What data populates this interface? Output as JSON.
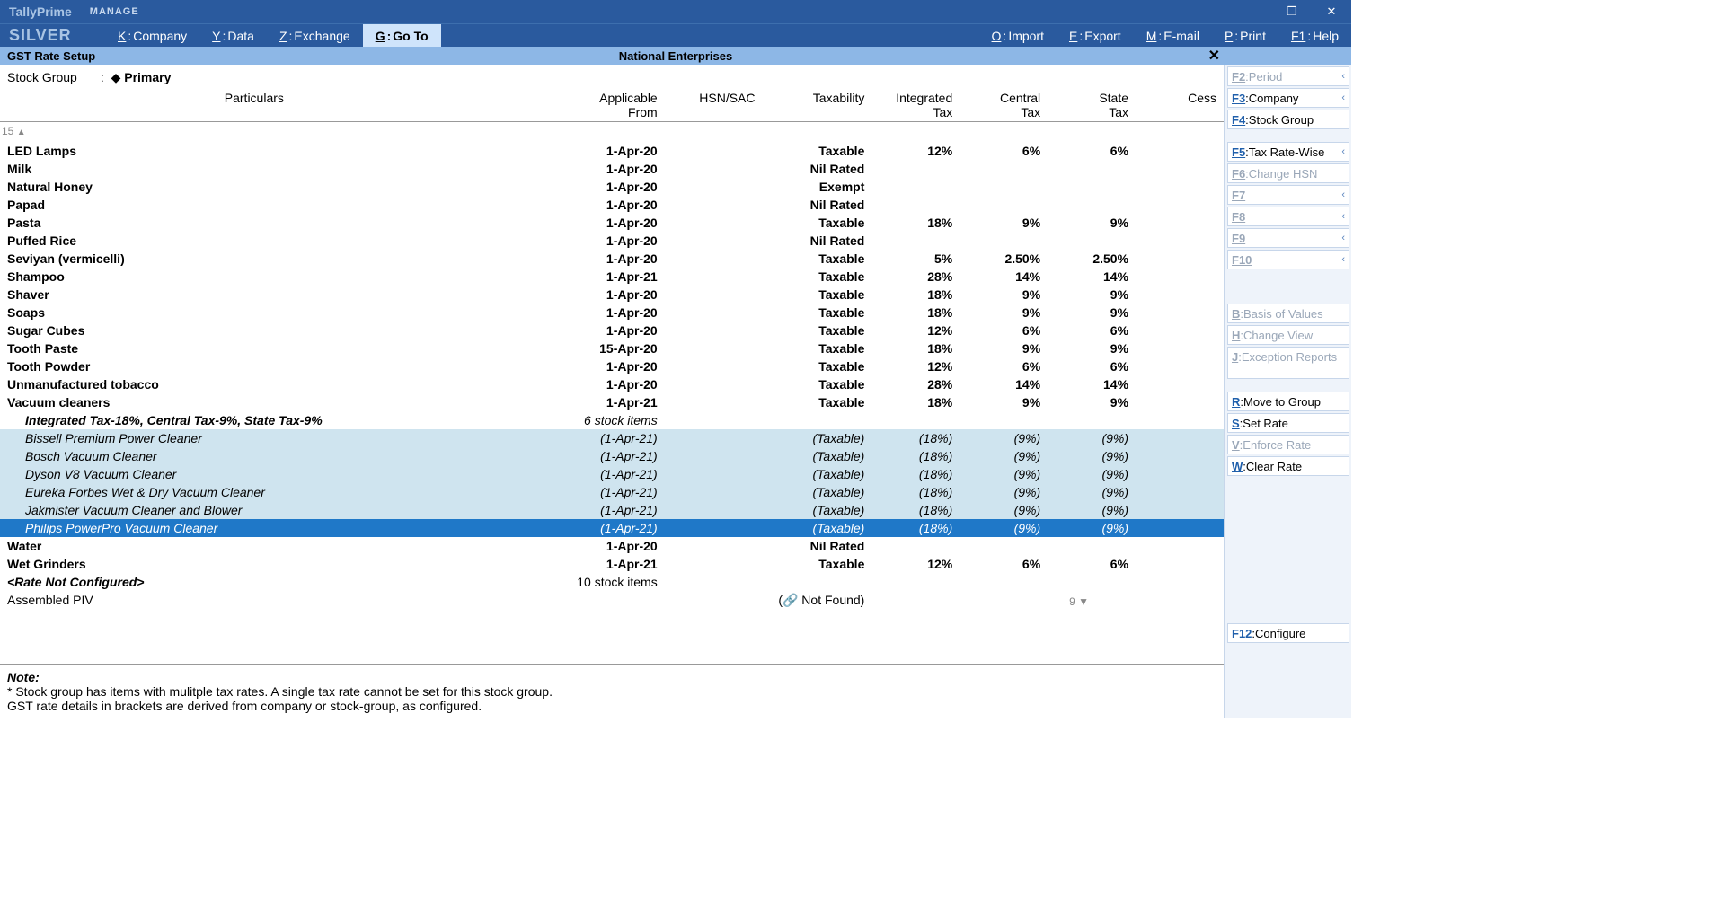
{
  "app": {
    "brand": "TallyPrime",
    "edition": "SILVER",
    "manage": "MANAGE"
  },
  "winbtn": {
    "min": "—",
    "max": "❐",
    "close": "✕"
  },
  "menu": [
    {
      "key": "K",
      "label": "Company"
    },
    {
      "key": "Y",
      "label": "Data"
    },
    {
      "key": "Z",
      "label": "Exchange"
    },
    {
      "key": "G",
      "label": "Go To",
      "active": true
    },
    {
      "key": "O",
      "label": "Import"
    },
    {
      "key": "E",
      "label": "Export"
    },
    {
      "key": "M",
      "label": "E-mail"
    },
    {
      "key": "P",
      "label": "Print"
    },
    {
      "key": "F1",
      "label": "Help"
    }
  ],
  "ctx": {
    "left": "GST Rate Setup",
    "center": "National Enterprises",
    "close": "✕"
  },
  "stockgroup": {
    "label": "Stock Group",
    "value": "Primary",
    "colon": ":",
    "diamond": "◆"
  },
  "columns": [
    "Particulars",
    "Applicable From",
    "HSN/SAC",
    "Taxability",
    "Integrated Tax",
    "Central Tax",
    "State Tax",
    "Cess"
  ],
  "topcount": "15",
  "toptri": "▲",
  "botcount": "9",
  "bottri": "▼",
  "rows": [
    {
      "t": "b",
      "p": "LED Lamps",
      "d": "1-Apr-20",
      "tx": "Taxable",
      "i": "12%",
      "c": "6%",
      "s": "6%"
    },
    {
      "t": "b",
      "p": "Milk",
      "d": "1-Apr-20",
      "tx": "Nil Rated"
    },
    {
      "t": "b",
      "p": "Natural Honey",
      "d": "1-Apr-20",
      "tx": "Exempt"
    },
    {
      "t": "b",
      "p": "Papad",
      "d": "1-Apr-20",
      "tx": "Nil Rated"
    },
    {
      "t": "b",
      "p": "Pasta",
      "d": "1-Apr-20",
      "tx": "Taxable",
      "i": "18%",
      "c": "9%",
      "s": "9%"
    },
    {
      "t": "b",
      "p": "Puffed Rice",
      "d": "1-Apr-20",
      "tx": "Nil Rated"
    },
    {
      "t": "b",
      "p": "Seviyan (vermicelli)",
      "d": "1-Apr-20",
      "tx": "Taxable",
      "i": "5%",
      "c": "2.50%",
      "s": "2.50%"
    },
    {
      "t": "b",
      "p": "Shampoo",
      "d": "1-Apr-21",
      "tx": "Taxable",
      "i": "28%",
      "c": "14%",
      "s": "14%"
    },
    {
      "t": "b",
      "p": "Shaver",
      "d": "1-Apr-20",
      "tx": "Taxable",
      "i": "18%",
      "c": "9%",
      "s": "9%"
    },
    {
      "t": "b",
      "p": "Soaps",
      "d": "1-Apr-20",
      "tx": "Taxable",
      "i": "18%",
      "c": "9%",
      "s": "9%"
    },
    {
      "t": "b",
      "p": "Sugar Cubes",
      "d": "1-Apr-20",
      "tx": "Taxable",
      "i": "12%",
      "c": "6%",
      "s": "6%"
    },
    {
      "t": "b",
      "p": "Tooth Paste",
      "d": "15-Apr-20",
      "tx": "Taxable",
      "i": "18%",
      "c": "9%",
      "s": "9%"
    },
    {
      "t": "b",
      "p": "Tooth Powder",
      "d": "1-Apr-20",
      "tx": "Taxable",
      "i": "12%",
      "c": "6%",
      "s": "6%"
    },
    {
      "t": "b",
      "p": "Unmanufactured tobacco",
      "d": "1-Apr-20",
      "tx": "Taxable",
      "i": "28%",
      "c": "14%",
      "s": "14%"
    },
    {
      "t": "b",
      "p": "Vacuum cleaners",
      "d": "1-Apr-21",
      "tx": "Taxable",
      "i": "18%",
      "c": "9%",
      "s": "9%"
    },
    {
      "t": "sh",
      "p": "Integrated Tax-18%, Central Tax-9%, State Tax-9%",
      "d": "6 stock items"
    },
    {
      "t": "ch",
      "p": "Bissell Premium Power Cleaner",
      "d": "(1-Apr-21)",
      "tx": "(Taxable)",
      "i": "(18%)",
      "c": "(9%)",
      "s": "(9%)"
    },
    {
      "t": "ch",
      "p": "Bosch Vacuum Cleaner",
      "d": "(1-Apr-21)",
      "tx": "(Taxable)",
      "i": "(18%)",
      "c": "(9%)",
      "s": "(9%)"
    },
    {
      "t": "ch",
      "p": "Dyson V8 Vacuum Cleaner",
      "d": "(1-Apr-21)",
      "tx": "(Taxable)",
      "i": "(18%)",
      "c": "(9%)",
      "s": "(9%)"
    },
    {
      "t": "ch",
      "p": "Eureka Forbes Wet & Dry Vacuum Cleaner",
      "d": "(1-Apr-21)",
      "tx": "(Taxable)",
      "i": "(18%)",
      "c": "(9%)",
      "s": "(9%)"
    },
    {
      "t": "ch",
      "p": "Jakmister Vacuum Cleaner and Blower",
      "d": "(1-Apr-21)",
      "tx": "(Taxable)",
      "i": "(18%)",
      "c": "(9%)",
      "s": "(9%)"
    },
    {
      "t": "chs",
      "p": "Philips PowerPro Vacuum Cleaner",
      "d": "(1-Apr-21)",
      "tx": "(Taxable)",
      "i": "(18%)",
      "c": "(9%)",
      "s": "(9%)"
    },
    {
      "t": "b",
      "p": "Water",
      "d": "1-Apr-20",
      "tx": "Nil Rated"
    },
    {
      "t": "b",
      "p": "Wet Grinders",
      "d": "1-Apr-21",
      "tx": "Taxable",
      "i": "12%",
      "c": "6%",
      "s": "6%"
    },
    {
      "t": "rnc",
      "p": "<Rate Not Configured>",
      "d": "10 stock items"
    },
    {
      "t": "n",
      "p": "Assembled PIV",
      "tx": "(🔗  Not Found)"
    }
  ],
  "notes": {
    "hd": "Note:",
    "l1": "* Stock group has items with mulitple tax rates. A single tax rate cannot be set for this stock group.",
    "l2": "GST rate details in brackets are derived from company or stock-group, as configured."
  },
  "side": [
    {
      "k": "F2",
      "l": "Period",
      "d": true,
      "c": true
    },
    {
      "k": "F3",
      "l": "Company",
      "c": true,
      "bold": true
    },
    {
      "k": "F4",
      "l": "Stock Group"
    },
    {
      "gap": 1
    },
    {
      "k": "F5",
      "l": "Tax Rate-Wise",
      "c": true,
      "bold": true
    },
    {
      "k": "F6",
      "l": "Change HSN",
      "d": true
    },
    {
      "k": "F7",
      "l": "",
      "d": true,
      "c": true
    },
    {
      "k": "F8",
      "l": "",
      "d": true,
      "c": true
    },
    {
      "k": "F9",
      "l": "",
      "d": true,
      "c": true
    },
    {
      "k": "F10",
      "l": "",
      "d": true,
      "c": true
    },
    {
      "gap": 2
    },
    {
      "k": "B",
      "l": "Basis of Values",
      "d": true
    },
    {
      "k": "H",
      "l": "Change View",
      "d": true
    },
    {
      "k": "J",
      "l": "Exception Reports",
      "d": true,
      "tall": true
    },
    {
      "gap": 1
    },
    {
      "k": "R",
      "l": "Move to Group"
    },
    {
      "k": "S",
      "l": "Set Rate"
    },
    {
      "k": "V",
      "l": "Enforce Rate",
      "d": true
    },
    {
      "k": "W",
      "l": "Clear Rate"
    },
    {
      "gap": 3
    },
    {
      "k": "F12",
      "l": "Configure",
      "bold": true
    }
  ]
}
